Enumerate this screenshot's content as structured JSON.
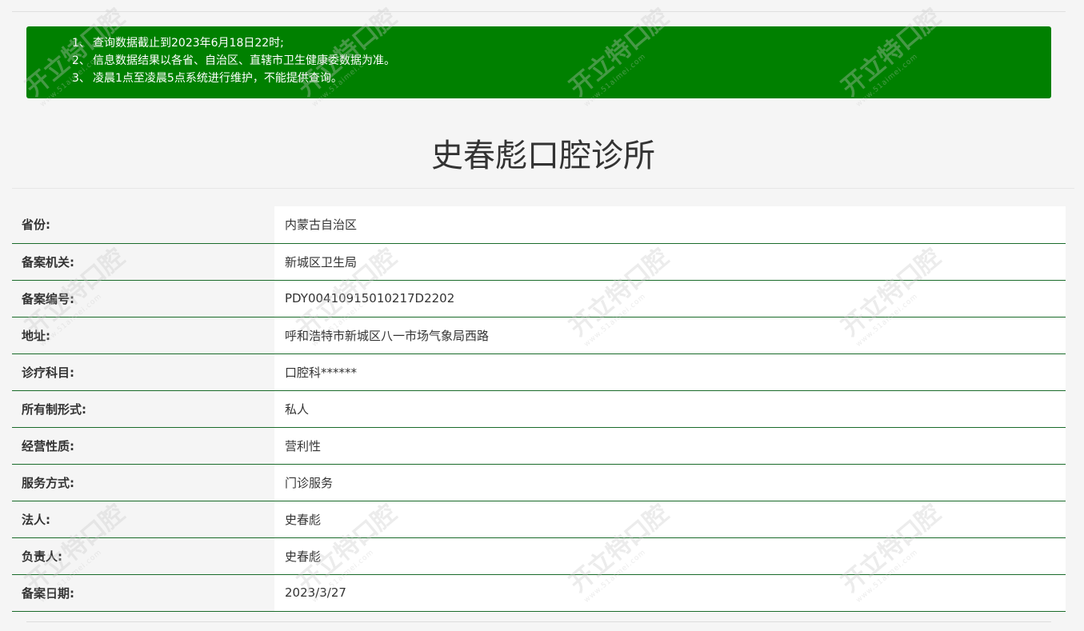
{
  "notice": {
    "items": [
      {
        "num": "1、",
        "text": "查询数据截止到2023年6月18日22时;"
      },
      {
        "num": "2、",
        "text": "信息数据结果以各省、自治区、直辖市卫生健康委数据为准。"
      },
      {
        "num": "3、",
        "text": "凌晨1点至凌晨5点系统进行维护，不能提供查询。"
      }
    ],
    "background_color": "#008000"
  },
  "page_title": "史春彪口腔诊所",
  "info_rows": [
    {
      "label": "省份:",
      "value": "内蒙古自治区"
    },
    {
      "label": "备案机关:",
      "value": "新城区卫生局"
    },
    {
      "label": "备案编号:",
      "value": "PDY00410915010217D2202"
    },
    {
      "label": "地址:",
      "value": "呼和浩特市新城区八一市场气象局西路"
    },
    {
      "label": "诊疗科目:",
      "value": "口腔科******"
    },
    {
      "label": "所有制形式:",
      "value": "私人"
    },
    {
      "label": "经营性质:",
      "value": "营利性"
    },
    {
      "label": "服务方式:",
      "value": "门诊服务"
    },
    {
      "label": "法人:",
      "value": "史春彪"
    },
    {
      "label": "负责人:",
      "value": "史春彪"
    },
    {
      "label": "备案日期:",
      "value": "2023/3/27"
    }
  ],
  "watermark": {
    "text": "开立特口腔",
    "url": "www.51aimei.com"
  },
  "colors": {
    "row_divider": "#1a6b2a",
    "label_bg": "#f5f5f5",
    "value_bg": "#ffffff"
  }
}
